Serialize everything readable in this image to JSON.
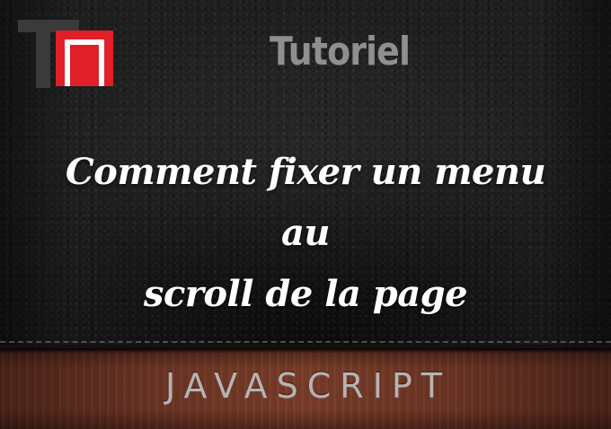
{
  "logo": {
    "icon": "tn-logo-icon",
    "colors": {
      "dark": "#3c3c3c",
      "accent": "#e0202a"
    }
  },
  "header": {
    "label": "Tutoriel"
  },
  "headline": {
    "line1": "Comment fixer un menu au",
    "line2": "scroll de la page"
  },
  "footer": {
    "category": "JAVASCRIPT"
  },
  "colors": {
    "leather": "#1e1e1e",
    "band": "#6b3424",
    "title_text": "#ffffff",
    "label_text": "#8f8f8f"
  }
}
